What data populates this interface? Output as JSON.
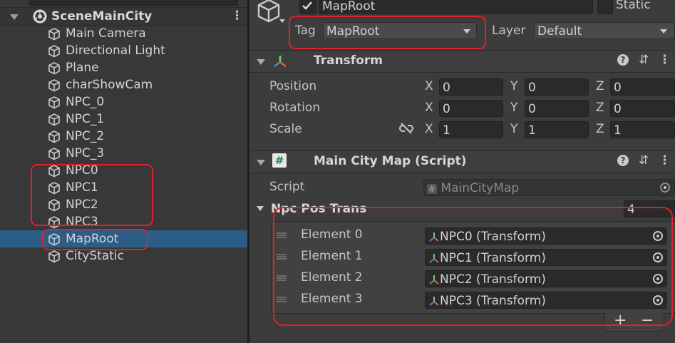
{
  "hierarchy": {
    "scene_name": "SceneMainCity",
    "items": [
      {
        "label": "Main Camera"
      },
      {
        "label": "Directional Light"
      },
      {
        "label": "Plane"
      },
      {
        "label": "charShowCam"
      },
      {
        "label": "NPC_0"
      },
      {
        "label": "NPC_1"
      },
      {
        "label": "NPC_2"
      },
      {
        "label": "NPC_3"
      },
      {
        "label": "NPC0"
      },
      {
        "label": "NPC1"
      },
      {
        "label": "NPC2"
      },
      {
        "label": "NPC3"
      },
      {
        "label": "MapRoot"
      },
      {
        "label": "CityStatic"
      }
    ],
    "selected": "MapRoot"
  },
  "inspector": {
    "object_name": "MapRoot",
    "static_label": "Static",
    "tag_label": "Tag",
    "tag_value": "MapRoot",
    "layer_label": "Layer",
    "layer_value": "Default",
    "transform": {
      "title": "Transform",
      "rows": [
        {
          "label": "Position",
          "x": "0",
          "y": "0",
          "z": "0"
        },
        {
          "label": "Rotation",
          "x": "0",
          "y": "0",
          "z": "0"
        },
        {
          "label": "Scale",
          "x": "1",
          "y": "1",
          "z": "1"
        }
      ],
      "axis_x": "X",
      "axis_y": "Y",
      "axis_z": "Z"
    },
    "script_component": {
      "title": "Main City Map (Script)",
      "script_label": "Script",
      "script_value": "MainCityMap",
      "list_label": "Npc Pos Trans",
      "list_count": "4",
      "elements": [
        {
          "label": "Element 0",
          "value": "NPC0 (Transform)"
        },
        {
          "label": "Element 1",
          "value": "NPC1 (Transform)"
        },
        {
          "label": "Element 2",
          "value": "NPC2 (Transform)"
        },
        {
          "label": "Element 3",
          "value": "NPC3 (Transform)"
        }
      ],
      "add_label": "+",
      "remove_label": "−"
    },
    "icons": {
      "help": "?",
      "menu": "⋮",
      "settings": "⇵"
    }
  },
  "colors": {
    "selection": "#2c5d87",
    "highlight": "#e0202a",
    "panel": "#3c3c3c"
  }
}
